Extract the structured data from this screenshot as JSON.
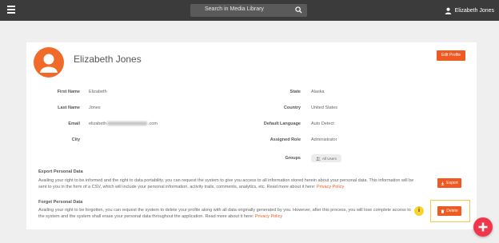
{
  "topbar": {
    "search_placeholder": "Search in Media Library",
    "user_name": "Elizabeth Jones"
  },
  "profile": {
    "name": "Elizabeth Jones",
    "edit_label": "Edit Profile",
    "fields_left": [
      {
        "label": "First Name",
        "value": "Elizabeth"
      },
      {
        "label": "Last Name",
        "value": "Jones"
      },
      {
        "label": "Email",
        "value_prefix": "elizabeth",
        "value_suffix": ".com"
      },
      {
        "label": "City",
        "value": ""
      }
    ],
    "fields_right": [
      {
        "label": "State",
        "value": "Alaska"
      },
      {
        "label": "Country",
        "value": "United States"
      },
      {
        "label": "Default Language",
        "value": "Auto Detect"
      },
      {
        "label": "Assigned Role",
        "value": "Administrator"
      },
      {
        "label": "Groups",
        "value": "All Users"
      }
    ]
  },
  "export": {
    "title": "Export Personal Data",
    "text": "Availing your right to be informed and the right to data portability, you can request the system to give you access to all information stored herein about your personal data. This information will be sent to you in the form of a CSV, which will include your personal information, activity trails, comments, analytics, etc. Read more about it here: ",
    "link": "Privacy Policy",
    "button_label": "Export"
  },
  "forget": {
    "title": "Forget Personal Data",
    "text": "Availing your right to be forgotten, you can request the system to delete your profile along with all data originally generated by you. However, after this process, you will lose complete access to the system and the system shall erase your personal data throughout the application. Read more about it here: ",
    "link": "Privacy Policy",
    "button_label": "Delete",
    "info_glyph": "i"
  },
  "colors": {
    "accent": "#f05a22",
    "topbar": "#3b3b3b",
    "highlight": "#f7c948",
    "fab": "#f0364a"
  },
  "icons": [
    "menu-icon",
    "search-icon",
    "user-icon",
    "avatar-person-icon",
    "users-icon",
    "download-icon",
    "trash-icon",
    "info-icon",
    "plus-icon"
  ]
}
